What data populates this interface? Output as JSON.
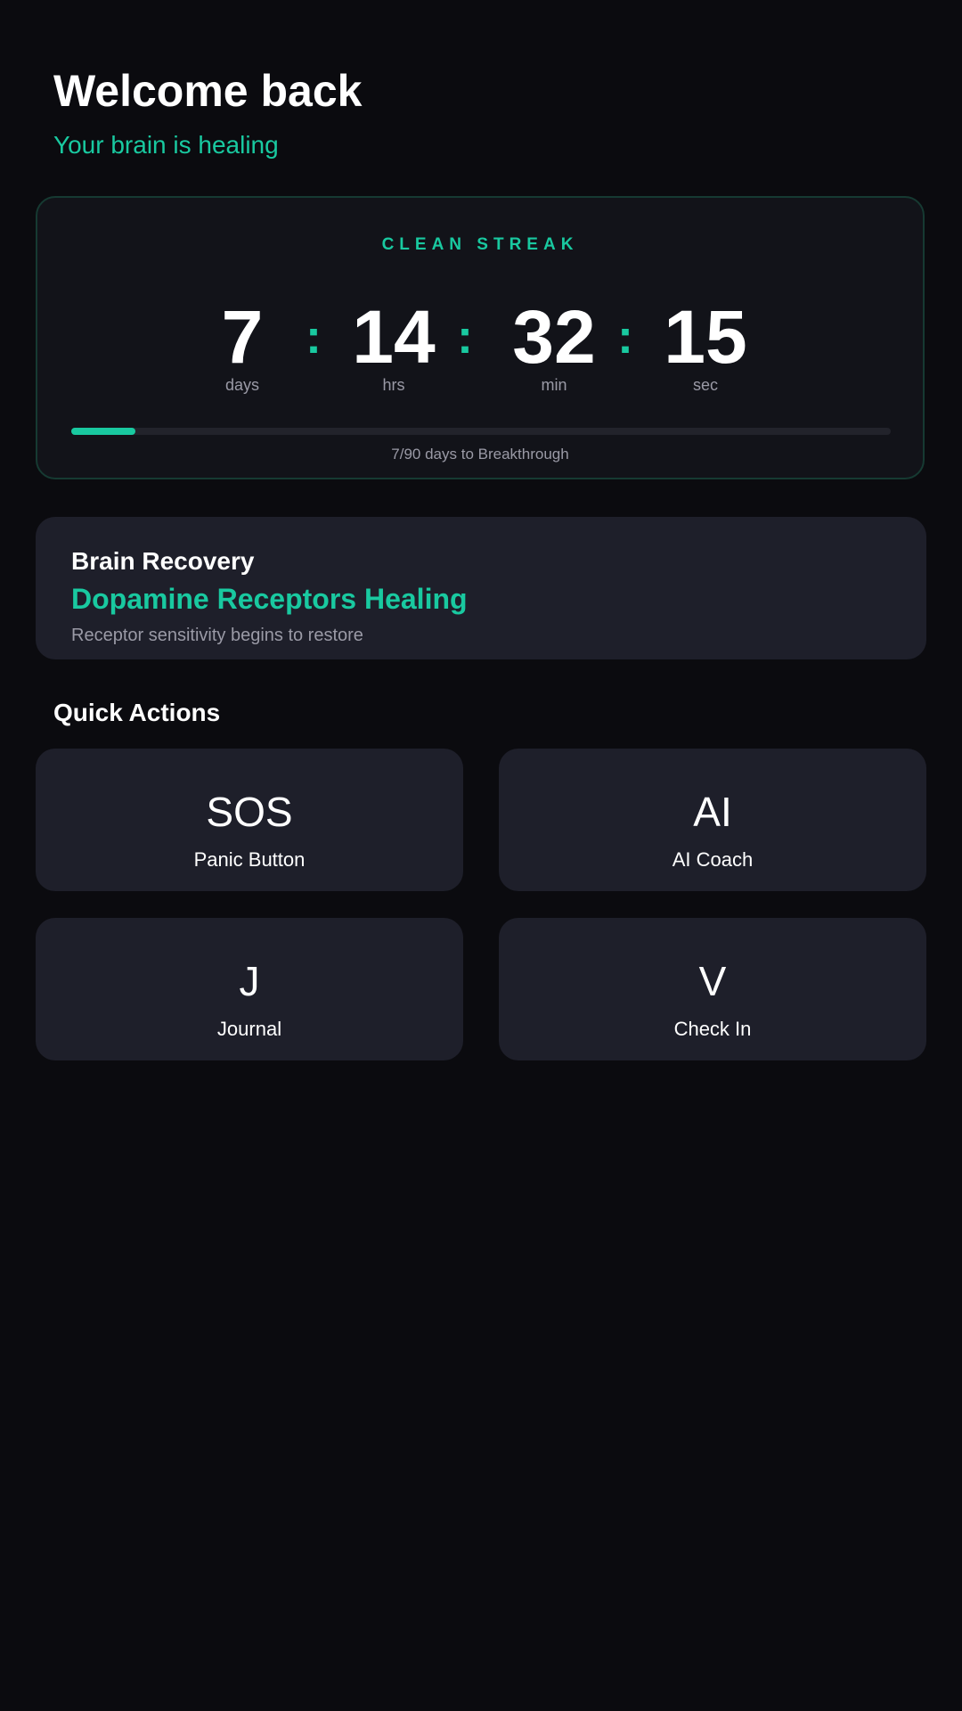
{
  "header": {
    "title": "Welcome back",
    "subtitle": "Your brain is healing"
  },
  "streak": {
    "label": "CLEAN STREAK",
    "days": "7",
    "hours": "14",
    "minutes": "32",
    "seconds": "15",
    "separator": ":",
    "days_unit": "days",
    "hours_unit": "hrs",
    "minutes_unit": "min",
    "seconds_unit": "sec",
    "progress_fraction": 0.078,
    "progress_text": "7/90 days to Breakthrough"
  },
  "recovery": {
    "heading": "Brain Recovery",
    "phase": "Dopamine Receptors Healing",
    "description": "Receptor sensitivity begins to restore"
  },
  "quick_actions": {
    "title": "Quick Actions",
    "items": [
      {
        "icon": "SOS",
        "icon_name": "sos-icon",
        "label": "Panic Button"
      },
      {
        "icon": "AI",
        "icon_name": "ai-icon",
        "label": "AI Coach"
      },
      {
        "icon": "J",
        "icon_name": "journal-icon",
        "label": "Journal"
      },
      {
        "icon": "V",
        "icon_name": "check-in-icon",
        "label": "Check In"
      }
    ]
  },
  "colors": {
    "background": "#0b0b0f",
    "accent": "#19c9a0",
    "card": "#1e1f2a",
    "streak_card": "#121319",
    "muted_text": "#9a9aa6"
  }
}
